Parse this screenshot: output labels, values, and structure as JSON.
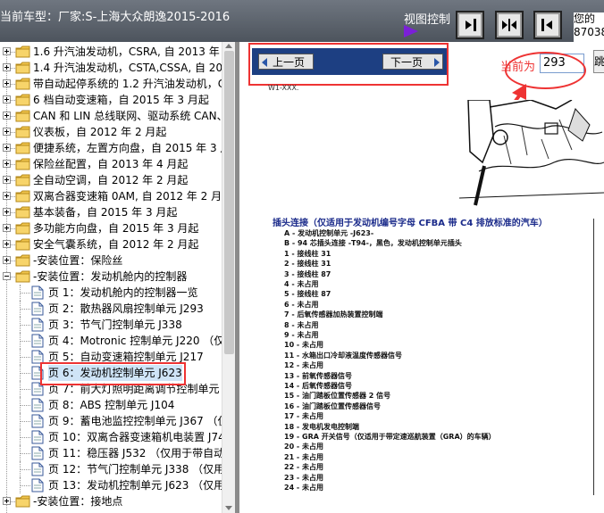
{
  "header": {
    "title": "当前车型：厂家:S-上海大众朗逸2015-2016",
    "view_control_label": "视图控制",
    "view_buttons": [
      "collapse-right",
      "split",
      "collapse-left"
    ],
    "user_text": "您的\n87038"
  },
  "tree": {
    "items": [
      {
        "type": "folder",
        "expand": "+",
        "label": "1.6 升汽油发动机，CSRA, 自 2013 年 4 月起"
      },
      {
        "type": "folder",
        "expand": "+",
        "label": "1.4 升汽油发动机，CSTA,CSSA, 自 2015 年"
      },
      {
        "type": "folder",
        "expand": "+",
        "label": "带自动起停系统的 1.2 升汽油发动机，CYA"
      },
      {
        "type": "folder",
        "expand": "+",
        "label": "6 档自动变速箱，自 2015 年 3 月起"
      },
      {
        "type": "folder",
        "expand": "+",
        "label": "CAN 和 LIN 总线联网、驱动系统 CAN、诊断"
      },
      {
        "type": "folder",
        "expand": "+",
        "label": "仪表板，自 2012 年 2 月起"
      },
      {
        "type": "folder",
        "expand": "+",
        "label": "便捷系统，左置方向盘，自 2015 年 3 月起"
      },
      {
        "type": "folder",
        "expand": "+",
        "label": "保险丝配置，自 2013 年 4 月起"
      },
      {
        "type": "folder",
        "expand": "+",
        "label": "全自动空调，自 2012 年 2 月起"
      },
      {
        "type": "folder",
        "expand": "+",
        "label": "双离合器变速箱 0AM, 自 2012 年 2 月起"
      },
      {
        "type": "folder",
        "expand": "+",
        "label": "基本装备，自 2015 年 3 月起"
      },
      {
        "type": "folder",
        "expand": "+",
        "label": "多功能方向盘，自 2015 年 3 月起"
      },
      {
        "type": "folder",
        "expand": "+",
        "label": "安全气囊系统，自 2012 年 2 月起"
      },
      {
        "type": "folder",
        "expand": "+",
        "label": "-安装位置：保险丝",
        "level": 1
      },
      {
        "type": "folder",
        "expand": "-",
        "label": "-安装位置：发动机舱内的控制器",
        "level": 1
      },
      {
        "type": "page",
        "label": "页 1：发动机舱内的控制器一览"
      },
      {
        "type": "page",
        "label": "页 2：散热器风扇控制单元 J293"
      },
      {
        "type": "page",
        "label": "页 3：节气门控制单元 J338"
      },
      {
        "type": "page",
        "label": "页 4：Motronic 控制单元 J220 （仅适"
      },
      {
        "type": "page",
        "label": "页 5：自动变速箱控制单元 J217"
      },
      {
        "type": "page",
        "label": "页 6：发动机控制单元 J623",
        "selected": true
      },
      {
        "type": "page",
        "label": "页 7：前大灯照明距离调节控制单元 J431"
      },
      {
        "type": "page",
        "label": "页 8：ABS 控制单元 J104"
      },
      {
        "type": "page",
        "label": "页 9：蓄电池监控控制单元 J367 （仅用"
      },
      {
        "type": "page",
        "label": "页 10：双离合器变速箱机电装置 J743"
      },
      {
        "type": "page",
        "label": "页 11：稳压器 J532 （仅用于带自动起"
      },
      {
        "type": "page",
        "label": "页 12：节气门控制单元 J338 （仅用于"
      },
      {
        "type": "page",
        "label": "页 13：发动机控制单元 J623 （仅用于"
      },
      {
        "type": "folder",
        "expand": "+",
        "label": "-安装位置：接地点",
        "level": 1
      }
    ]
  },
  "pager": {
    "prev_label": "上一页",
    "next_label": "下一页",
    "current_label": "当前为",
    "current_page": "293",
    "jump_label": "跳"
  },
  "document": {
    "note": "W1-XXX.",
    "heading": "插头连接（仅适用于发动机编号字母 CFBA 带 C4 排放标准的汽车）",
    "lines": [
      "A - 发动机控制单元 -J623-",
      "B - 94 芯插头连接 -T94-，黑色，发动机控制单元插头",
      "1 - 接线柱 31",
      "2 - 接线柱 31",
      "3 - 接线柱 87",
      "4 - 未占用",
      "5 - 接线柱 87",
      "6 - 未占用",
      "7 - 后氧传感器加热装置控制端",
      "8 - 未占用",
      "9 - 未占用",
      "10 - 未占用",
      "11 - 水箱出口冷却液温度传感器信号",
      "12 - 未占用",
      "13 - 前氧传感器信号",
      "14 - 后氧传感器信号",
      "15 - 油门踏板位置传感器 2 信号",
      "16 - 油门踏板位置传感器信号",
      "17 - 未占用",
      "18 - 发电机发电控制端",
      "19 - GRA 开关信号（仅适用于带定速巡航装置（GRA）的车辆）",
      "20 - 未占用",
      "21 - 未占用",
      "22 - 未占用",
      "23 - 未占用",
      "24 - 未占用"
    ]
  },
  "colors": {
    "header_bg": "#5a6069",
    "pager_bar": "#1d3f82",
    "highlight_red": "#e33333",
    "selected_bg": "#cfe4f7",
    "heading_blue": "#1a2a8a",
    "purple_marker": "#7b1fd8"
  }
}
